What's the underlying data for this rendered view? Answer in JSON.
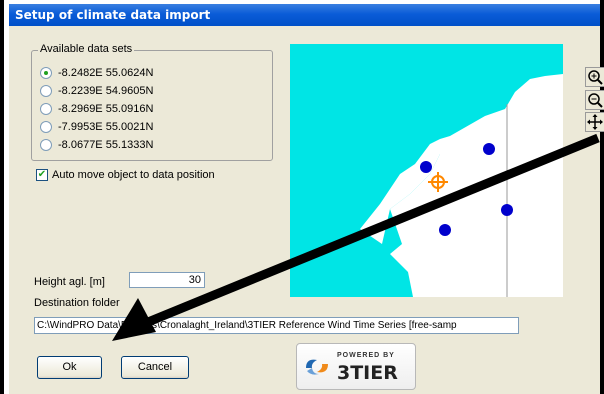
{
  "dialog": {
    "title": "Setup of climate data import"
  },
  "datasets": {
    "legend": "Available data sets",
    "items": [
      {
        "label": "-8.2482E 55.0624N",
        "selected": true
      },
      {
        "label": "-8.2239E 54.9605N",
        "selected": false
      },
      {
        "label": "-8.2969E 55.0916N",
        "selected": false
      },
      {
        "label": "-7.9953E 55.0021N",
        "selected": false
      },
      {
        "label": "-8.0677E 55.1333N",
        "selected": false
      }
    ]
  },
  "auto_move": {
    "label": "Auto move object to data position",
    "checked": true
  },
  "height": {
    "label": "Height agl. [m]",
    "value": "30"
  },
  "destination": {
    "label": "Destination folder",
    "value": "C:\\WindPRO Data\\Projects\\Cronalaght_Ireland\\3TIER Reference Wind Time Series [free-samp"
  },
  "buttons": {
    "ok": "Ok",
    "cancel": "Cancel"
  },
  "logo": {
    "powered": "POWERED BY",
    "name": "3TIER"
  },
  "map_tools": [
    "zoom-in-icon",
    "zoom-out-icon",
    "pan-icon"
  ],
  "colors": {
    "title_bar": "#0a5cd8",
    "sea": "#00e5e5",
    "land": "#ffffff",
    "data_point": "#0000cc",
    "selected_marker": "#ff8800"
  }
}
